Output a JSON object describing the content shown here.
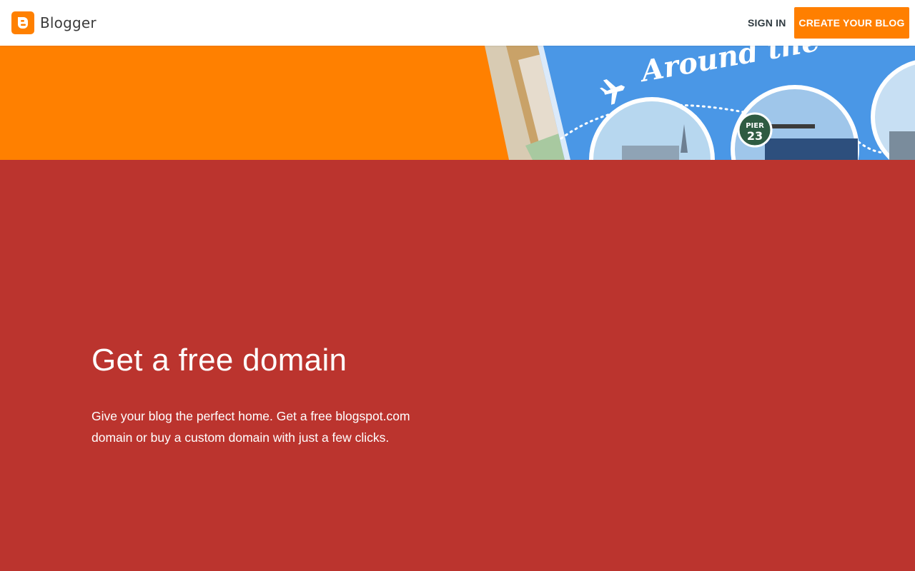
{
  "header": {
    "brand_name": "Blogger",
    "logo_icon": "blogger-logo-icon",
    "sign_in_label": "SIGN IN",
    "create_button_label": "CREATE YOUR BLOG"
  },
  "hero": {
    "banner_text": "Around the",
    "badge_line1": "PIER",
    "badge_line2": "23",
    "icons": [
      "airplane-icon"
    ]
  },
  "feature": {
    "title": "Get a free domain",
    "description": "Give your blog the perfect home. Get a free blogspot.com domain or buy a custom domain with just a few clicks."
  },
  "colors": {
    "brand_orange": "#ff8000",
    "feature_red": "#bb342e",
    "hero_blue": "#4a97e6",
    "header_text": "#2f3a40"
  }
}
